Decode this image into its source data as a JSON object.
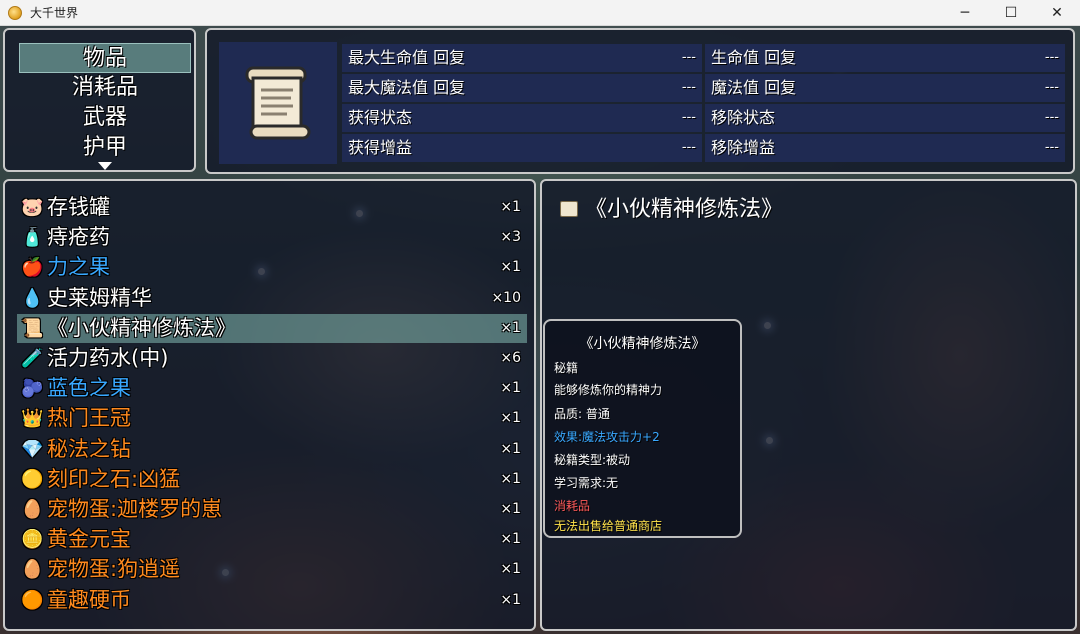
{
  "window": {
    "title": "大千世界",
    "minimize": "─",
    "maximize": "☐",
    "close": "✕"
  },
  "categories": [
    {
      "label": "物品"
    },
    {
      "label": "消耗品"
    },
    {
      "label": "武器"
    },
    {
      "label": "护甲"
    }
  ],
  "stats": [
    {
      "label": "最大生命值 回复",
      "value": "---"
    },
    {
      "label": "生命值 回复",
      "value": "---"
    },
    {
      "label": "最大魔法值 回复",
      "value": "---"
    },
    {
      "label": "魔法值 回复",
      "value": "---"
    },
    {
      "label": "获得状态",
      "value": "---"
    },
    {
      "label": "移除状态",
      "value": "---"
    },
    {
      "label": "获得增益",
      "value": "---"
    },
    {
      "label": "移除增益",
      "value": "---"
    }
  ],
  "items": [
    {
      "name": "存钱罐",
      "count": "×1",
      "icon": "piggy-bank-icon",
      "color": "#ffffff",
      "glyph": "🐷"
    },
    {
      "name": "痔疮药",
      "count": "×3",
      "icon": "medicine-bottle-icon",
      "color": "#ffffff",
      "glyph": "🧴"
    },
    {
      "name": "力之果",
      "count": "×1",
      "icon": "red-fruit-icon",
      "color": "#39a8ff",
      "glyph": "🍎"
    },
    {
      "name": "史莱姆精华",
      "count": "×10",
      "icon": "slime-icon",
      "color": "#ffffff",
      "glyph": "💧"
    },
    {
      "name": "《小伙精神修炼法》",
      "count": "×1",
      "icon": "scroll-icon",
      "color": "#ffffff",
      "glyph": "📜"
    },
    {
      "name": "活力药水(中)",
      "count": "×6",
      "icon": "potion-icon",
      "color": "#ffffff",
      "glyph": "🧪"
    },
    {
      "name": "蓝色之果",
      "count": "×1",
      "icon": "blue-fruit-icon",
      "color": "#39a8ff",
      "glyph": "🫐"
    },
    {
      "name": "热门王冠",
      "count": "×1",
      "icon": "crown-icon",
      "color": "#ff8a1e",
      "glyph": "👑"
    },
    {
      "name": "秘法之钻",
      "count": "×1",
      "icon": "purple-gem-icon",
      "color": "#ff8a1e",
      "glyph": "💎"
    },
    {
      "name": "刻印之石:凶猛",
      "count": "×1",
      "icon": "yellow-stone-icon",
      "color": "#ff8a1e",
      "glyph": "🟡"
    },
    {
      "name": "宠物蛋:迦楼罗的崽",
      "count": "×1",
      "icon": "egg-icon",
      "color": "#ff8a1e",
      "glyph": "🥚"
    },
    {
      "name": "黄金元宝",
      "count": "×1",
      "icon": "gold-ingot-icon",
      "color": "#ff8a1e",
      "glyph": "🪙"
    },
    {
      "name": "宠物蛋:狗逍遥",
      "count": "×1",
      "icon": "egg-icon",
      "color": "#ff8a1e",
      "glyph": "🥚"
    },
    {
      "name": "童趣硬币",
      "count": "×1",
      "icon": "coin-icon",
      "color": "#ff8a1e",
      "glyph": "🟠"
    }
  ],
  "selected_index": 4,
  "detail": {
    "title": "《小伙精神修炼法》"
  },
  "tooltip": {
    "title": "《小伙精神修炼法》",
    "type": "秘籍",
    "desc": "能够修炼你的精神力",
    "quality": "品质: 普通",
    "effect": "效果:魔法攻击力+2",
    "book_type": "秘籍类型:被动",
    "requirement": "学习需求:无",
    "category": "消耗品",
    "sell_note": "无法出售给普通商店"
  },
  "colors": {
    "effect": "#39a8ff",
    "category": "#ff5a5a",
    "sell_note": "#ffe24a",
    "panel_border": "#c9c9c9",
    "stat_cell": "#1f2a52"
  }
}
